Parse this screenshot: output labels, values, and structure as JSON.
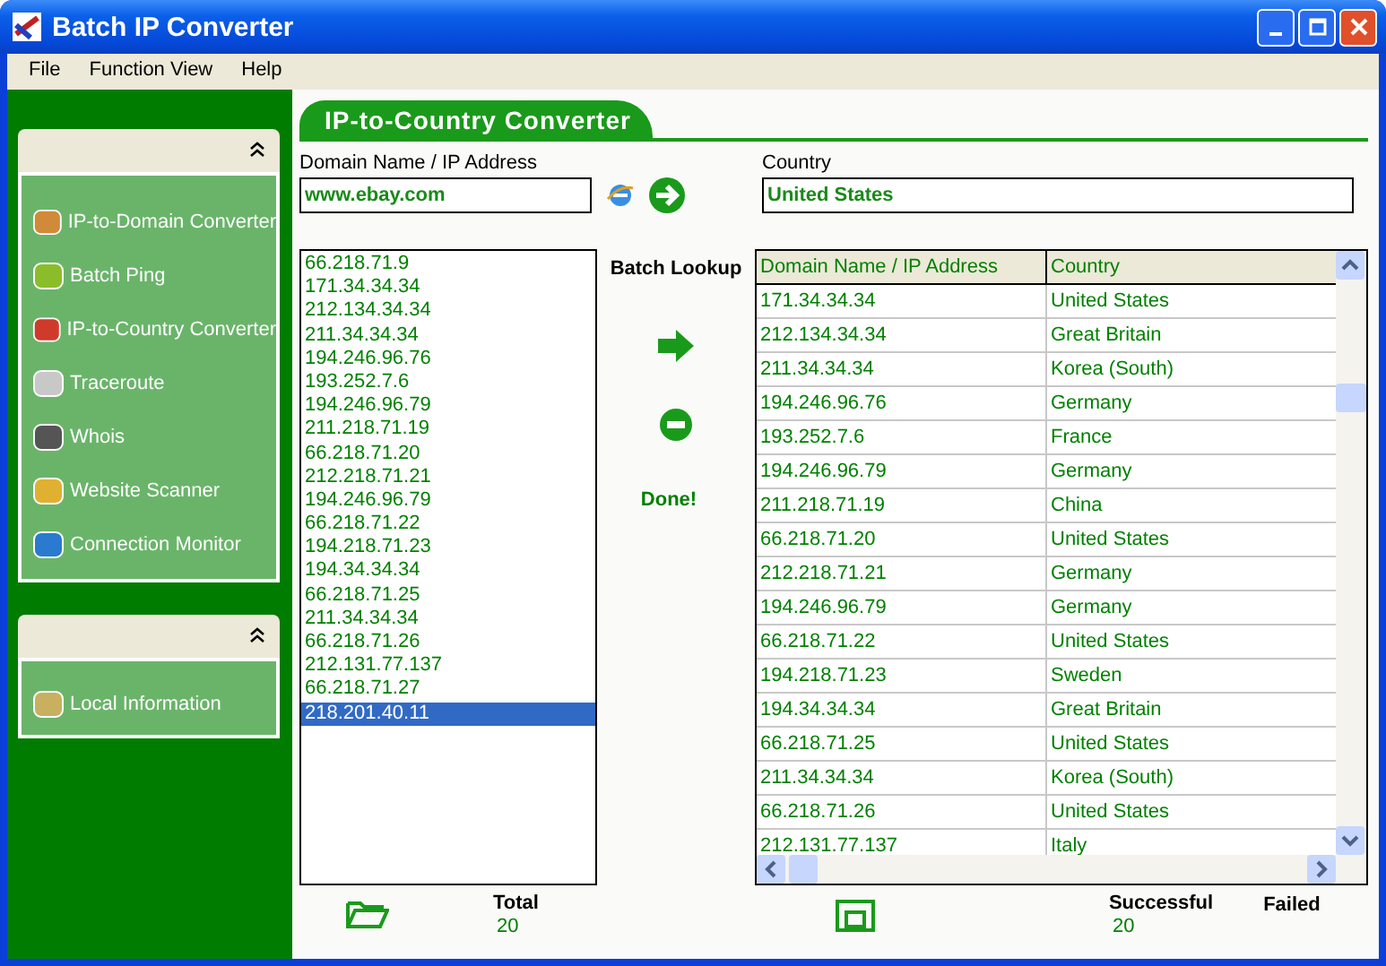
{
  "window": {
    "title": "Batch IP Converter"
  },
  "menu": [
    "File",
    "Function View",
    "Help"
  ],
  "sidebar": {
    "panels": [
      {
        "expanded": true,
        "items": [
          "IP-to-Domain Converter",
          "Batch Ping",
          "IP-to-Country Converter",
          "Traceroute",
          "Whois",
          "Website Scanner",
          "Connection Monitor"
        ]
      },
      {
        "expanded": true,
        "items": [
          "Local Information"
        ]
      }
    ]
  },
  "converter": {
    "title": "IP-to-Country Converter",
    "query_label": "Domain Name / IP Address",
    "query_value": "www.ebay.com",
    "country_label": "Country",
    "country_value": "United States"
  },
  "batch": {
    "input_list": [
      {
        "text": "66.218.71.9",
        "selected": false
      },
      {
        "text": "171.34.34.34",
        "selected": false
      },
      {
        "text": "212.134.34.34",
        "selected": false
      },
      {
        "text": "211.34.34.34",
        "selected": false
      },
      {
        "text": "194.246.96.76",
        "selected": false
      },
      {
        "text": "193.252.7.6",
        "selected": false
      },
      {
        "text": "194.246.96.79",
        "selected": false
      },
      {
        "text": "211.218.71.19",
        "selected": false
      },
      {
        "text": "66.218.71.20",
        "selected": false
      },
      {
        "text": "212.218.71.21",
        "selected": false
      },
      {
        "text": "194.246.96.79",
        "selected": false
      },
      {
        "text": "66.218.71.22",
        "selected": false
      },
      {
        "text": "194.218.71.23",
        "selected": false
      },
      {
        "text": "194.34.34.34",
        "selected": false
      },
      {
        "text": "66.218.71.25",
        "selected": false
      },
      {
        "text": "211.34.34.34",
        "selected": false
      },
      {
        "text": "66.218.71.26",
        "selected": false
      },
      {
        "text": "212.131.77.137",
        "selected": false
      },
      {
        "text": "66.218.71.27",
        "selected": false
      },
      {
        "text": "218.201.40.11",
        "selected": true
      }
    ],
    "lookup_label": "Batch Lookup",
    "status": "Done!",
    "table": {
      "columns": [
        "Domain Name / IP Address",
        "Country"
      ],
      "rows": [
        [
          "171.34.34.34",
          "United States"
        ],
        [
          "212.134.34.34",
          "Great Britain"
        ],
        [
          "211.34.34.34",
          "Korea (South)"
        ],
        [
          "194.246.96.76",
          "Germany"
        ],
        [
          "193.252.7.6",
          "France"
        ],
        [
          "194.246.96.79",
          "Germany"
        ],
        [
          "211.218.71.19",
          "China"
        ],
        [
          "66.218.71.20",
          "United States"
        ],
        [
          "212.218.71.21",
          "Germany"
        ],
        [
          "194.246.96.79",
          "Germany"
        ],
        [
          "66.218.71.22",
          "United States"
        ],
        [
          "194.218.71.23",
          "Sweden"
        ],
        [
          "194.34.34.34",
          "Great Britain"
        ],
        [
          "66.218.71.25",
          "United States"
        ],
        [
          "211.34.34.34",
          "Korea (South)"
        ],
        [
          "66.218.71.26",
          "United States"
        ],
        [
          "212.131.77.137",
          "Italy"
        ]
      ]
    }
  },
  "footer": {
    "total_label": "Total",
    "total": "20",
    "successful_label": "Successful",
    "successful": "20",
    "failed_label": "Failed"
  }
}
